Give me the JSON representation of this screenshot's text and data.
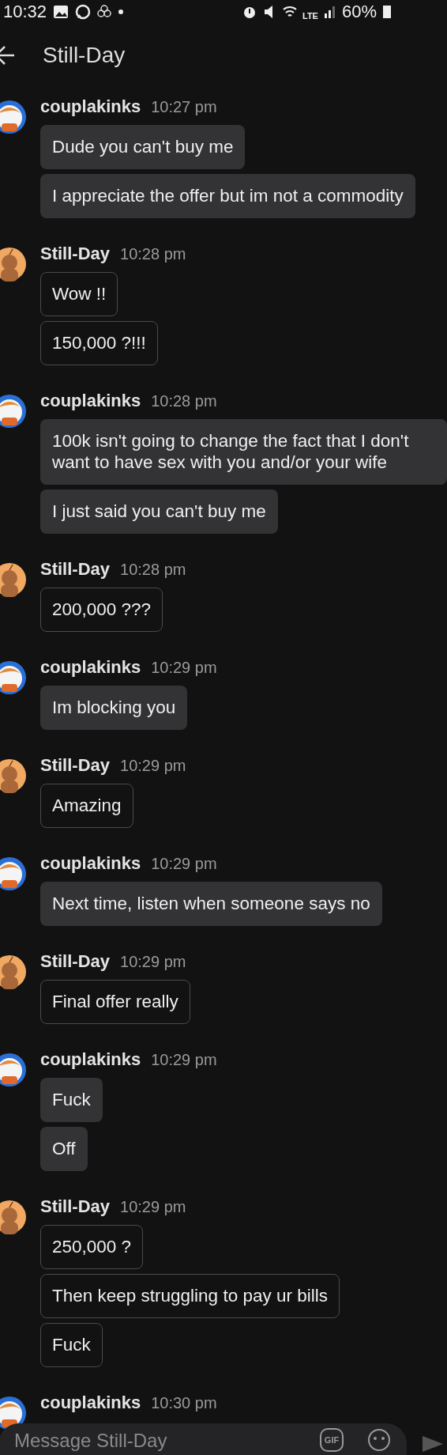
{
  "status_bar": {
    "time": "10:32",
    "network": "LTE",
    "battery": "60%"
  },
  "header": {
    "title": "Still-Day"
  },
  "groups": [
    {
      "kind": "me",
      "author": "couplakinks",
      "time": "10:27 pm",
      "messages": [
        "Dude you can't buy me",
        "I appreciate the offer but im not a commodity"
      ]
    },
    {
      "kind": "them",
      "author": "Still-Day",
      "time": "10:28 pm",
      "messages": [
        "Wow !!",
        "150,000 ?!!!"
      ]
    },
    {
      "kind": "me",
      "author": "couplakinks",
      "time": "10:28 pm",
      "messages": [
        "100k isn't going to change the fact that I don't want to have sex with you and/or your wife",
        "I just said you can't buy me"
      ]
    },
    {
      "kind": "them",
      "author": "Still-Day",
      "time": "10:28 pm",
      "messages": [
        "200,000 ???"
      ]
    },
    {
      "kind": "me",
      "author": "couplakinks",
      "time": "10:29 pm",
      "messages": [
        "Im blocking you"
      ]
    },
    {
      "kind": "them",
      "author": "Still-Day",
      "time": "10:29 pm",
      "messages": [
        "Amazing"
      ]
    },
    {
      "kind": "me",
      "author": "couplakinks",
      "time": "10:29 pm",
      "messages": [
        "Next time, listen when someone says no"
      ]
    },
    {
      "kind": "them",
      "author": "Still-Day",
      "time": "10:29 pm",
      "messages": [
        "Final offer really"
      ]
    },
    {
      "kind": "me",
      "author": "couplakinks",
      "time": "10:29 pm",
      "messages": [
        "Fuck",
        "Off"
      ]
    },
    {
      "kind": "them",
      "author": "Still-Day",
      "time": "10:29 pm",
      "messages": [
        "250,000 ?",
        "Then keep struggling to pay ur bills",
        "Fuck"
      ]
    },
    {
      "kind": "me",
      "author": "couplakinks",
      "time": "10:30 pm"
    }
  ],
  "composer": {
    "placeholder": "Message Still-Day",
    "gif_label": "GIF"
  }
}
